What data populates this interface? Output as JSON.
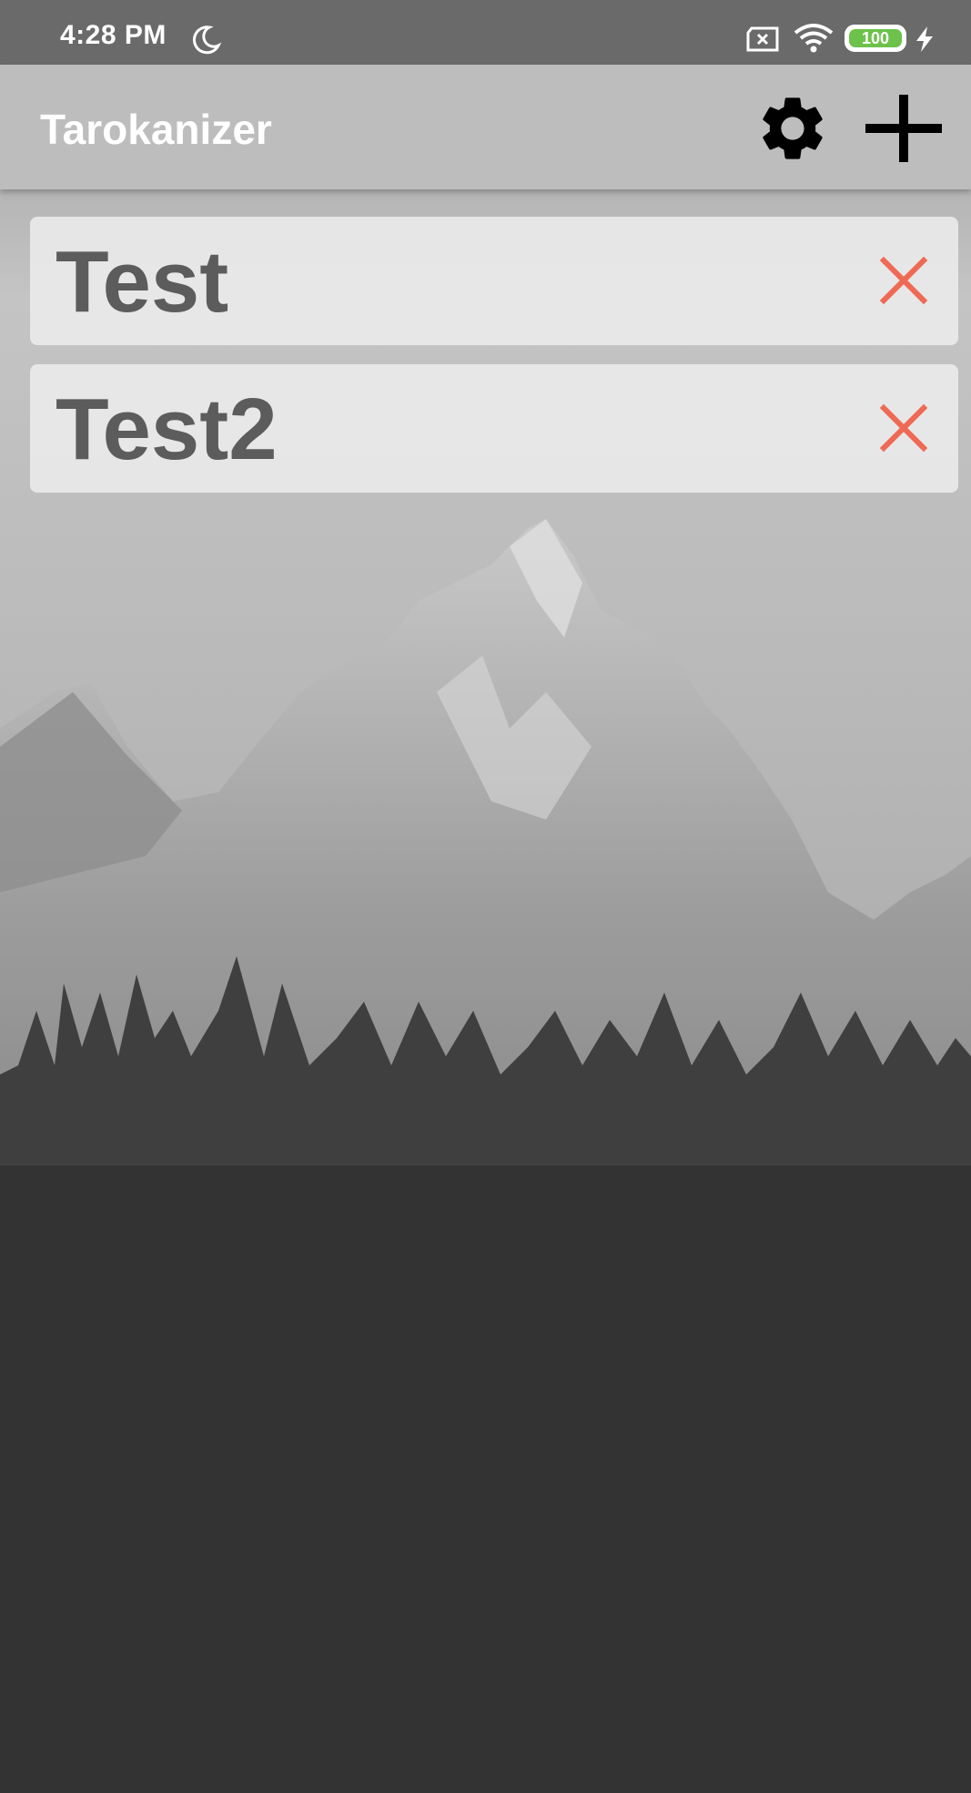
{
  "status_bar": {
    "time": "4:28 PM",
    "battery_level": "100",
    "battery_color": "#6cc24a",
    "icons": [
      "moon-icon",
      "sim-off-icon",
      "wifi-icon",
      "battery-icon",
      "charging-bolt-icon"
    ]
  },
  "app_bar": {
    "title": "Tarokanizer",
    "actions": [
      {
        "name": "settings",
        "icon": "gear-icon"
      },
      {
        "name": "add",
        "icon": "plus-icon"
      }
    ]
  },
  "list": {
    "items": [
      {
        "title": "Test",
        "delete_icon": "close-icon"
      },
      {
        "title": "Test2",
        "delete_icon": "close-icon"
      }
    ]
  },
  "colors": {
    "status_bar_bg": "#6a6a6a",
    "app_bar_bg": "#bdbdbd",
    "item_text": "#5c5c5c",
    "delete_icon": "#ef6a55",
    "action_icons": "#000000"
  }
}
